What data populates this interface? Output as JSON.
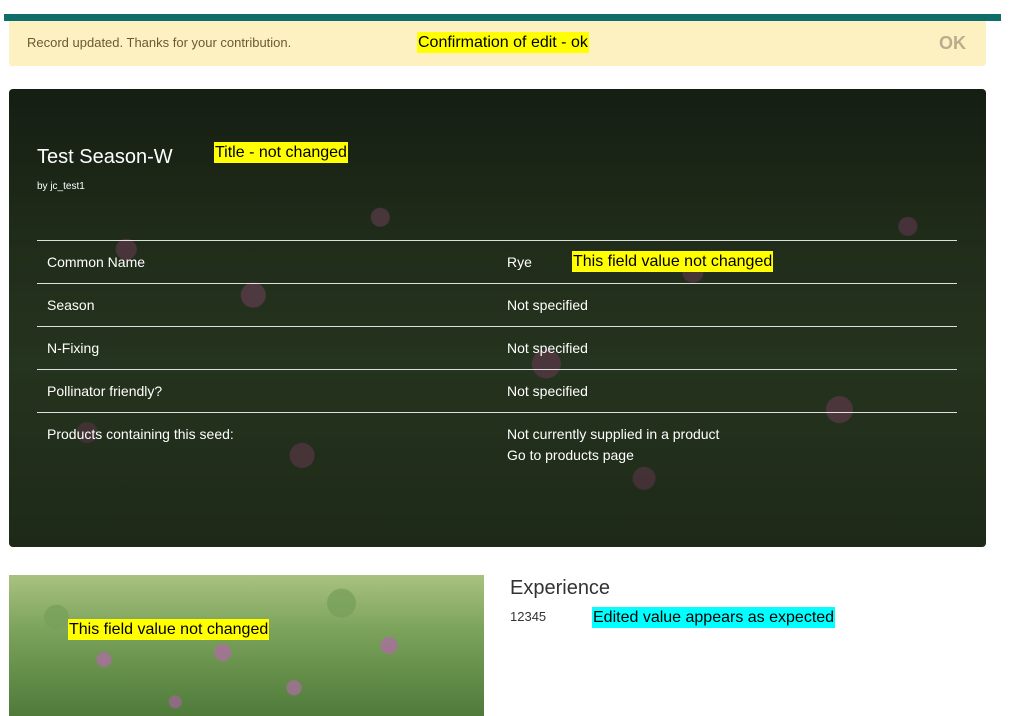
{
  "alert": {
    "message": "Record updated. Thanks for your contribution.",
    "ok_label": "OK"
  },
  "annotations": {
    "confirmation": "Confirmation of edit - ok",
    "title_note": "Title - not changed",
    "common_name_note": "This field value not changed",
    "image_note": "This field value not changed",
    "experience_note": "Edited value appears as expected"
  },
  "record": {
    "title": "Test Season-W",
    "author": "by jc_test1",
    "fields": [
      {
        "label": "Common Name",
        "value": "Rye"
      },
      {
        "label": "Season",
        "value": "Not specified"
      },
      {
        "label": "N-Fixing",
        "value": "Not specified"
      },
      {
        "label": "Pollinator friendly?",
        "value": "Not specified"
      },
      {
        "label": "Products containing this seed:",
        "value": "Not currently supplied in a product",
        "link": "Go to products page"
      }
    ]
  },
  "experience": {
    "title": "Experience",
    "value": "12345"
  },
  "colors": {
    "topbar": "#0f6e6a",
    "alert_bg": "#fdf1c2",
    "highlight_yellow": "#ffff00",
    "highlight_cyan": "#00ffff"
  }
}
